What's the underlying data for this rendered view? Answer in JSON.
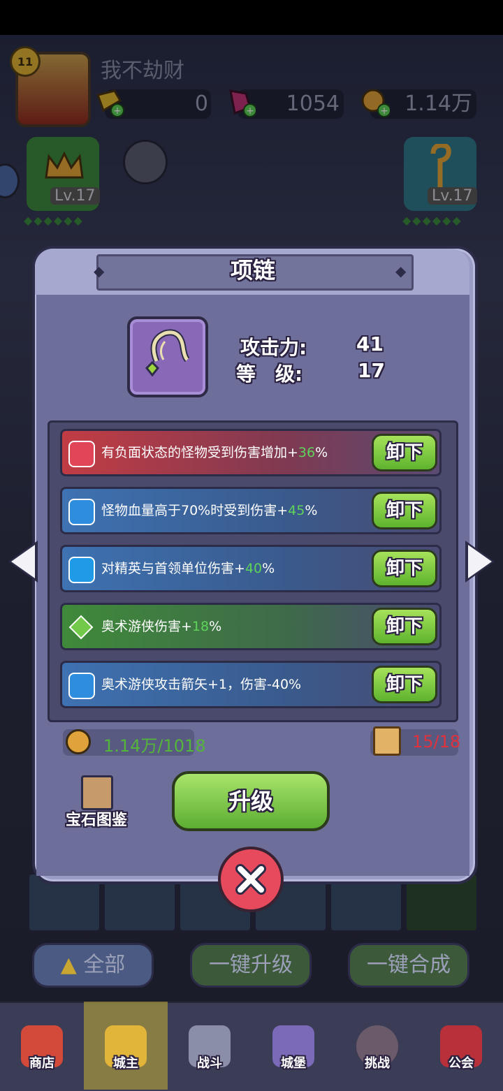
{
  "player": {
    "level_badge": "11",
    "name": "我不劫财"
  },
  "resources": [
    {
      "icon": "gold-bar-icon",
      "value": "0"
    },
    {
      "icon": "pink-gem-icon",
      "value": "1054"
    },
    {
      "icon": "coin-icon",
      "value": "1.14万"
    }
  ],
  "side_cards": {
    "left_level": "Lv.17",
    "right_level": "Lv.17"
  },
  "dialog": {
    "title": "项链",
    "item_icon": "necklace-icon",
    "stats": [
      {
        "label": "攻击力:",
        "value": "41"
      },
      {
        "label": "等　级:",
        "value": "17"
      }
    ],
    "gems": [
      {
        "icon": "red-gem-icon",
        "text": "有负面状态的怪物受到伤害增加+",
        "pct": "36",
        "suffix": "%",
        "button": "卸下",
        "color": "#b8373f"
      },
      {
        "icon": "blue-swirl-gem-icon",
        "text": "怪物血量高于70%时受到伤害+",
        "pct": "45",
        "suffix": "%",
        "button": "卸下",
        "color": "#3b6aa6"
      },
      {
        "icon": "blue-gem-icon",
        "text": "对精英与首领单位伤害+",
        "pct": "40",
        "suffix": "%",
        "button": "卸下",
        "color": "#3b6aa6"
      },
      {
        "icon": "green-gem-icon",
        "text": "奥术游侠伤害+",
        "pct": "18",
        "suffix": "%",
        "button": "卸下",
        "color": "#3f8a3a"
      },
      {
        "icon": "blue-swirl-gem-icon",
        "text": "奥术游侠攻击箭矢+1，伤害-40%",
        "pct": "",
        "suffix": "",
        "button": "卸下",
        "color": "#3b6aa6"
      }
    ],
    "gold_cost": "1.14万/1018",
    "scroll_cost": "15/18",
    "codex_label": "宝石图鉴",
    "upgrade_label": "升级"
  },
  "bottom_buttons": {
    "all": "全部",
    "upgrade_all": "一键升级",
    "merge_all": "一键合成"
  },
  "nav": [
    {
      "label": "商店",
      "icon": "shop-icon"
    },
    {
      "label": "城主",
      "icon": "crown-icon"
    },
    {
      "label": "战斗",
      "icon": "swords-icon"
    },
    {
      "label": "城堡",
      "icon": "castle-icon"
    },
    {
      "label": "挑战",
      "icon": "demon-icon"
    },
    {
      "label": "公会",
      "icon": "guild-banner-icon"
    }
  ],
  "colors": {
    "green_pct": "#5fd35a",
    "red_cost": "#e0323c",
    "green_cost": "#54b53b"
  }
}
